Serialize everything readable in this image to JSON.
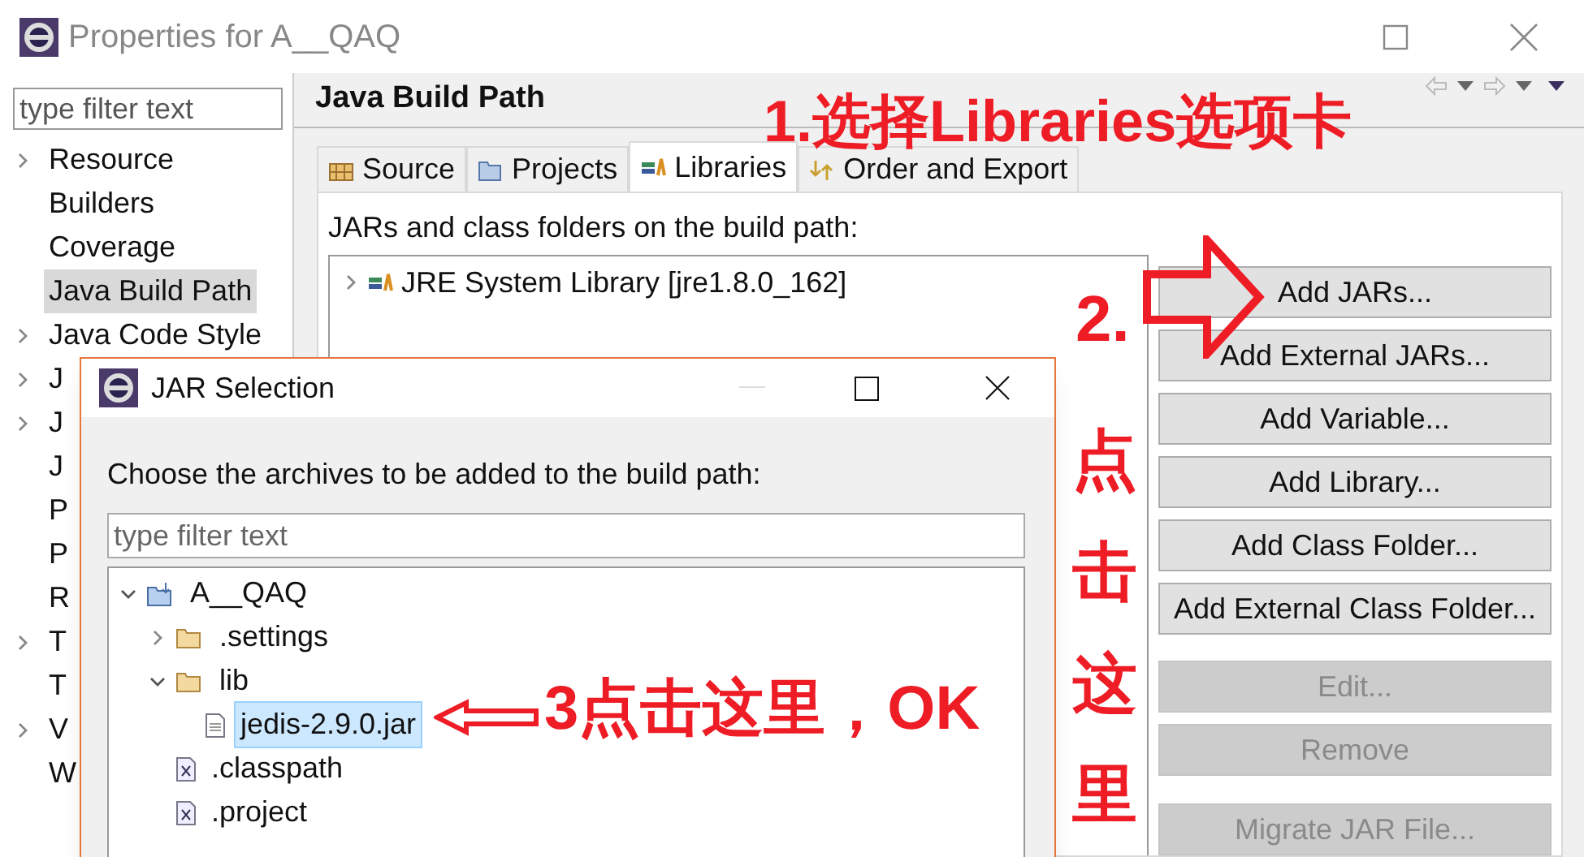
{
  "window": {
    "title": "Properties for A__QAQ"
  },
  "sidebar": {
    "search": {
      "placeholder": "type filter text"
    },
    "items": [
      {
        "label": "Resource",
        "expandable": true,
        "selected": false
      },
      {
        "label": "Builders",
        "expandable": false,
        "selected": false
      },
      {
        "label": "Coverage",
        "expandable": false,
        "selected": false
      },
      {
        "label": "Java Build Path",
        "expandable": false,
        "selected": true
      },
      {
        "label": "Java Code Style",
        "expandable": true,
        "selected": false
      },
      {
        "label": "J",
        "expandable": true,
        "selected": false
      },
      {
        "label": "J",
        "expandable": true,
        "selected": false
      },
      {
        "label": "J",
        "expandable": false,
        "selected": false
      },
      {
        "label": "P",
        "expandable": false,
        "selected": false
      },
      {
        "label": "P",
        "expandable": false,
        "selected": false
      },
      {
        "label": "R",
        "expandable": false,
        "selected": false
      },
      {
        "label": "T",
        "expandable": true,
        "selected": false
      },
      {
        "label": "T",
        "expandable": false,
        "selected": false
      },
      {
        "label": "V",
        "expandable": true,
        "selected": false
      },
      {
        "label": "W",
        "expandable": false,
        "selected": false
      }
    ]
  },
  "page": {
    "title": "Java Build Path",
    "tabs": [
      {
        "label": "Source",
        "kind": "source",
        "selected": false
      },
      {
        "label": "Projects",
        "kind": "projects",
        "selected": false
      },
      {
        "label": "Libraries",
        "kind": "libraries",
        "selected": true
      },
      {
        "label": "Order and Export",
        "kind": "order",
        "selected": false
      }
    ],
    "list_label": "JARs and class folders on the build path:",
    "entries": [
      {
        "label": "JRE System Library [jre1.8.0_162]",
        "expanded": false
      }
    ],
    "buttons": [
      {
        "label": "Add JARs...",
        "disabled": false
      },
      {
        "label": "Add External JARs...",
        "disabled": false
      },
      {
        "label": "Add Variable...",
        "disabled": false
      },
      {
        "label": "Add Library...",
        "disabled": false
      },
      {
        "label": "Add Class Folder...",
        "disabled": false
      },
      {
        "label": "Add External Class Folder...",
        "disabled": false
      },
      {
        "label": "Edit...",
        "disabled": true
      },
      {
        "label": "Remove",
        "disabled": true
      },
      {
        "label": "Migrate JAR File...",
        "disabled": true
      }
    ]
  },
  "dialog": {
    "title": "JAR Selection",
    "message": "Choose the archives to be added to the build path:",
    "search": {
      "placeholder": "type filter text"
    },
    "tree": [
      {
        "label": "A__QAQ",
        "kind": "project",
        "expanded": true,
        "selected": false,
        "children": [
          {
            "label": ".settings",
            "kind": "folder",
            "expanded": false,
            "selected": false
          },
          {
            "label": "lib",
            "kind": "folder",
            "expanded": true,
            "selected": false,
            "children": [
              {
                "label": "jedis-2.9.0.jar",
                "kind": "file",
                "selected": true
              }
            ]
          },
          {
            "label": ".classpath",
            "kind": "xml",
            "selected": false
          },
          {
            "label": ".project",
            "kind": "xml",
            "selected": false
          }
        ]
      }
    ]
  },
  "annotations": [
    {
      "kind": "text",
      "text": "1.选择Libraries选项卡"
    },
    {
      "kind": "text",
      "text": "2."
    },
    {
      "kind": "vertical",
      "text": "点击这里"
    },
    {
      "kind": "text",
      "text": "3点击这里，OK"
    }
  ]
}
